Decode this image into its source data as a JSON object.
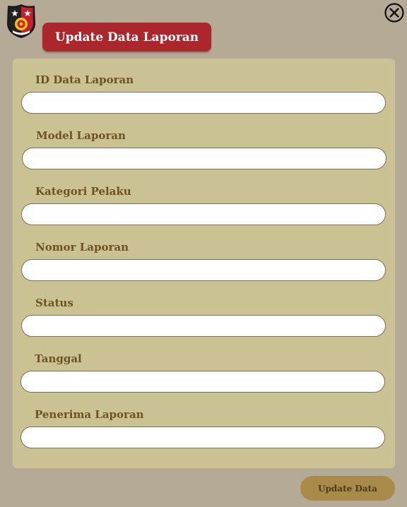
{
  "header": {
    "title": "Update Data Laporan",
    "logo_icon": "police-badge-icon",
    "close_icon": "close-circle-icon"
  },
  "form": {
    "fields": [
      {
        "label": "ID Data Laporan",
        "value": "",
        "placeholder": ""
      },
      {
        "label": "Model Laporan",
        "value": "",
        "placeholder": ""
      },
      {
        "label": "Kategori Pelaku",
        "value": "",
        "placeholder": ""
      },
      {
        "label": "Nomor Laporan",
        "value": "",
        "placeholder": ""
      },
      {
        "label": "Status",
        "value": "",
        "placeholder": ""
      },
      {
        "label": "Tanggal",
        "value": "",
        "placeholder": ""
      },
      {
        "label": "Penerima Laporan",
        "value": "",
        "placeholder": ""
      }
    ],
    "submit_label": "Update Data"
  },
  "colors": {
    "background": "#b4aa96",
    "panel": "#cbc294",
    "banner": "#ac272c",
    "label_text": "#6d5222",
    "button": "#a88a4b"
  }
}
